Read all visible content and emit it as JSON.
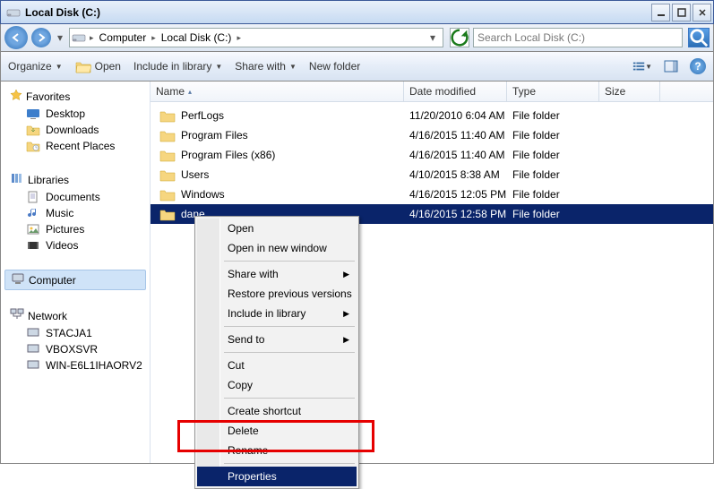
{
  "window": {
    "title": "Local Disk (C:)"
  },
  "nav": {
    "breadcrumb": [
      "Computer",
      "Local Disk (C:)"
    ],
    "search_placeholder": "Search Local Disk (C:)"
  },
  "toolbar": {
    "organize": "Organize",
    "open": "Open",
    "include": "Include in library",
    "share": "Share with",
    "newfolder": "New folder"
  },
  "navpane": {
    "favorites": {
      "label": "Favorites",
      "items": [
        "Desktop",
        "Downloads",
        "Recent Places"
      ]
    },
    "libraries": {
      "label": "Libraries",
      "items": [
        "Documents",
        "Music",
        "Pictures",
        "Videos"
      ]
    },
    "computer": {
      "label": "Computer"
    },
    "network": {
      "label": "Network",
      "items": [
        "STACJA1",
        "VBOXSVR",
        "WIN-E6L1IHAORV2"
      ]
    }
  },
  "columns": {
    "name": "Name",
    "date": "Date modified",
    "type": "Type",
    "size": "Size"
  },
  "rows": [
    {
      "name": "PerfLogs",
      "date": "11/20/2010 6:04 AM",
      "type": "File folder"
    },
    {
      "name": "Program Files",
      "date": "4/16/2015 11:40 AM",
      "type": "File folder"
    },
    {
      "name": "Program Files (x86)",
      "date": "4/16/2015 11:40 AM",
      "type": "File folder"
    },
    {
      "name": "Users",
      "date": "4/10/2015 8:38 AM",
      "type": "File folder"
    },
    {
      "name": "Windows",
      "date": "4/16/2015 12:05 PM",
      "type": "File folder"
    },
    {
      "name": "dane",
      "date": "4/16/2015 12:58 PM",
      "type": "File folder",
      "selected": true
    }
  ],
  "context_menu": {
    "items": [
      {
        "label": "Open"
      },
      {
        "label": "Open in new window"
      },
      {
        "sep": true
      },
      {
        "label": "Share with",
        "submenu": true
      },
      {
        "label": "Restore previous versions"
      },
      {
        "label": "Include in library",
        "submenu": true
      },
      {
        "sep": true
      },
      {
        "label": "Send to",
        "submenu": true
      },
      {
        "sep": true
      },
      {
        "label": "Cut"
      },
      {
        "label": "Copy"
      },
      {
        "sep": true
      },
      {
        "label": "Create shortcut"
      },
      {
        "label": "Delete"
      },
      {
        "label": "Rename"
      },
      {
        "sep": true
      },
      {
        "label": "Properties",
        "highlighted": true
      }
    ]
  }
}
